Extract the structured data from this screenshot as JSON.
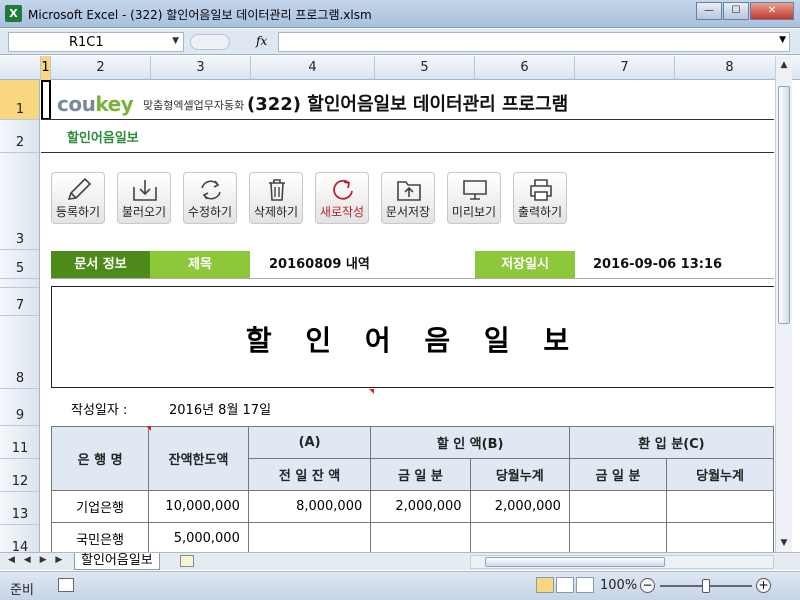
{
  "window": {
    "title": "Microsoft Excel - (322) 할인어음일보 데이터관리 프로그램.xlsm",
    "app_icon": "X",
    "minimize": "—",
    "maximize": "☐",
    "close": "✕"
  },
  "formula_bar": {
    "name_box": "R1C1",
    "fx_label": "fx",
    "formula": ""
  },
  "columns": [
    "1",
    "2",
    "3",
    "4",
    "5",
    "6",
    "7",
    "8"
  ],
  "rows": [
    "1",
    "2",
    "3",
    "5",
    "7",
    "8",
    "9",
    "11",
    "12",
    "13",
    "14"
  ],
  "sheet": {
    "logo_main": "cou",
    "logo_key": "key",
    "logo_sub": "맞춤형엑셀업무자동화",
    "program_title": "(322) 할인어음일보 데이터관리 프로그램",
    "subtitle": "할인어음일보",
    "toolbar": [
      {
        "label": "등록하기",
        "icon": "pencil-icon"
      },
      {
        "label": "불러오기",
        "icon": "open-tray-icon"
      },
      {
        "label": "수정하기",
        "icon": "refresh-icon"
      },
      {
        "label": "삭제하기",
        "icon": "trash-icon"
      },
      {
        "label": "새로작성",
        "icon": "new-reload-icon"
      },
      {
        "label": "문서저장",
        "icon": "folder-save-icon"
      },
      {
        "label": "미리보기",
        "icon": "monitor-icon"
      },
      {
        "label": "출력하기",
        "icon": "printer-icon"
      }
    ],
    "info": {
      "doc_info_label": "문서 정보",
      "title_label": "제목",
      "title_value": "20160809 내역",
      "saved_label": "저장일시",
      "saved_value": "2016-09-06 13:16"
    },
    "doc_title": "할 인 어 음 일 보",
    "date_label": "작성일자 :",
    "date_value": "2016년 8월 17일",
    "table": {
      "h_bank": "은 행 명",
      "h_limit": "잔액한도액",
      "h_a": "(A)",
      "h_b": "할 인 액(B)",
      "h_c": "환 입 분(C)",
      "h_prev": "전 일 잔 액",
      "h_today_b": "금 일 분",
      "h_month_b": "당월누계",
      "h_today_c": "금 일 분",
      "h_month_c": "당월누계",
      "rows": [
        {
          "bank": "기업은행",
          "limit": "10,000,000",
          "prev": "8,000,000",
          "today_b": "2,000,000",
          "month_b": "2,000,000",
          "today_c": "",
          "month_c": ""
        },
        {
          "bank": "국민은행",
          "limit": "5,000,000",
          "prev": "",
          "today_b": "",
          "month_b": "",
          "today_c": "",
          "month_c": ""
        }
      ]
    }
  },
  "tabs": {
    "nav": "◀ ◀ ▶ ▶",
    "active": "할인어음일보"
  },
  "status": {
    "ready": "준비",
    "zoom": "100%",
    "zoom_minus": "−",
    "zoom_plus": "+"
  }
}
